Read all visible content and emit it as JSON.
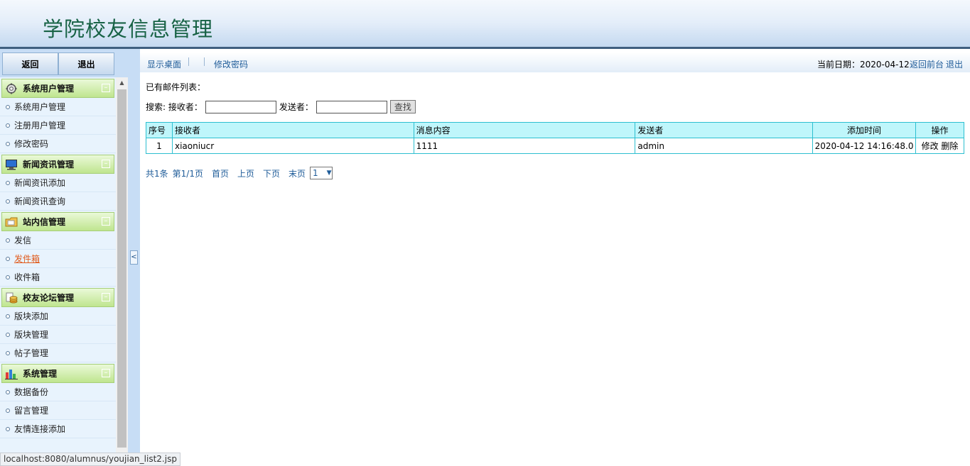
{
  "header": {
    "title": "学院校友信息管理"
  },
  "sidebar": {
    "back_label": "返回",
    "logout_label": "退出",
    "groups": [
      {
        "label": "系统用户管理",
        "icon": "gear-icon",
        "items": [
          "系统用户管理",
          "注册用户管理",
          "修改密码"
        ]
      },
      {
        "label": "新闻资讯管理",
        "icon": "monitor-icon",
        "items": [
          "新闻资讯添加",
          "新闻资讯查询"
        ]
      },
      {
        "label": "站内信管理",
        "icon": "folder-icon",
        "items": [
          "发信",
          "发件箱",
          "收件箱"
        ]
      },
      {
        "label": "校友论坛管理",
        "icon": "coins-icon",
        "items": [
          "版块添加",
          "版块管理",
          "帖子管理"
        ]
      },
      {
        "label": "系统管理",
        "icon": "bar-chart-icon",
        "items": [
          "数据备份",
          "留言管理",
          "友情连接添加"
        ]
      }
    ],
    "active_item": "发件箱",
    "collapse_glyph": "–",
    "toggle_glyph": "<"
  },
  "topnav": {
    "show_desktop": "显示桌面",
    "change_password": "修改密码",
    "date_label": "当前日期：2020-04-12",
    "back_front": "返回前台",
    "logout": "退出"
  },
  "main": {
    "list_title": "已有邮件列表：",
    "search": {
      "label_prefix": "搜索: 接收者：",
      "sender_label": "发送者：",
      "receiver_value": "",
      "sender_value": "",
      "button": "查找"
    },
    "table": {
      "headers": [
        "序号",
        "接收者",
        "消息内容",
        "发送者",
        "添加时间",
        "操作"
      ],
      "rows": [
        {
          "no": "1",
          "receiver": "xiaoniucr",
          "content": "1111",
          "sender": "admin",
          "time": "2020-04-12 14:16:48.0",
          "edit": "修改",
          "delete": "删除"
        }
      ]
    },
    "pager": {
      "total": "共1条",
      "page": "第1/1页",
      "first": "首页",
      "prev": "上页",
      "next": "下页",
      "last": "末页",
      "select_value": "1"
    }
  },
  "statusbar": {
    "url": "localhost:8080/alumnus/youjian_list2.jsp"
  }
}
